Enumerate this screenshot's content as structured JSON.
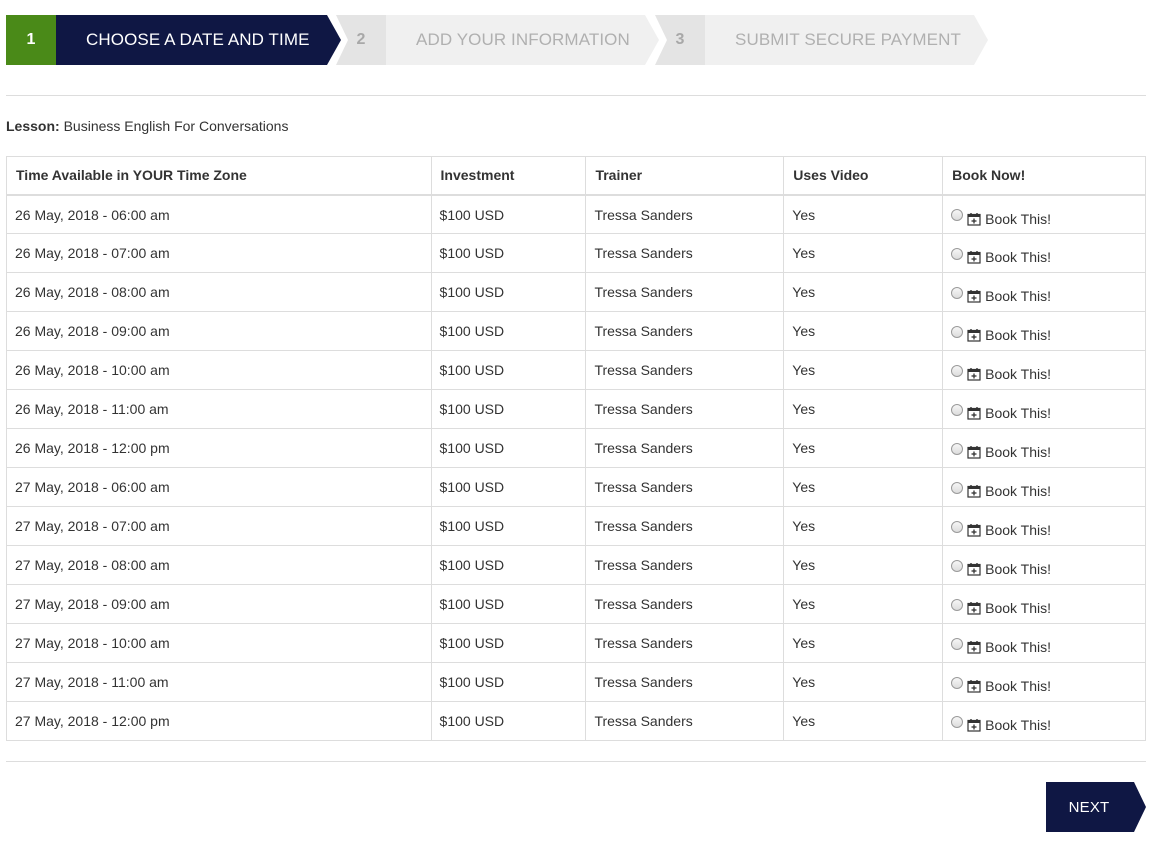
{
  "stepper": {
    "steps": [
      {
        "number": "1",
        "label": "CHOOSE A DATE AND TIME"
      },
      {
        "number": "2",
        "label": "ADD YOUR INFORMATION"
      },
      {
        "number": "3",
        "label": "SUBMIT SECURE PAYMENT"
      }
    ]
  },
  "lesson": {
    "label": "Lesson:",
    "value": "Business English For Conversations"
  },
  "table": {
    "headers": [
      "Time Available in YOUR Time Zone",
      "Investment",
      "Trainer",
      "Uses Video",
      "Book Now!"
    ],
    "rows": [
      {
        "time": "26 May, 2018 - 06:00 am",
        "investment": "$100 USD",
        "trainer": "Tressa Sanders",
        "video": "Yes",
        "book": "Book This!"
      },
      {
        "time": "26 May, 2018 - 07:00 am",
        "investment": "$100 USD",
        "trainer": "Tressa Sanders",
        "video": "Yes",
        "book": "Book This!"
      },
      {
        "time": "26 May, 2018 - 08:00 am",
        "investment": "$100 USD",
        "trainer": "Tressa Sanders",
        "video": "Yes",
        "book": "Book This!"
      },
      {
        "time": "26 May, 2018 - 09:00 am",
        "investment": "$100 USD",
        "trainer": "Tressa Sanders",
        "video": "Yes",
        "book": "Book This!"
      },
      {
        "time": "26 May, 2018 - 10:00 am",
        "investment": "$100 USD",
        "trainer": "Tressa Sanders",
        "video": "Yes",
        "book": "Book This!"
      },
      {
        "time": "26 May, 2018 - 11:00 am",
        "investment": "$100 USD",
        "trainer": "Tressa Sanders",
        "video": "Yes",
        "book": "Book This!"
      },
      {
        "time": "26 May, 2018 - 12:00 pm",
        "investment": "$100 USD",
        "trainer": "Tressa Sanders",
        "video": "Yes",
        "book": "Book This!"
      },
      {
        "time": "27 May, 2018 - 06:00 am",
        "investment": "$100 USD",
        "trainer": "Tressa Sanders",
        "video": "Yes",
        "book": "Book This!"
      },
      {
        "time": "27 May, 2018 - 07:00 am",
        "investment": "$100 USD",
        "trainer": "Tressa Sanders",
        "video": "Yes",
        "book": "Book This!"
      },
      {
        "time": "27 May, 2018 - 08:00 am",
        "investment": "$100 USD",
        "trainer": "Tressa Sanders",
        "video": "Yes",
        "book": "Book This!"
      },
      {
        "time": "27 May, 2018 - 09:00 am",
        "investment": "$100 USD",
        "trainer": "Tressa Sanders",
        "video": "Yes",
        "book": "Book This!"
      },
      {
        "time": "27 May, 2018 - 10:00 am",
        "investment": "$100 USD",
        "trainer": "Tressa Sanders",
        "video": "Yes",
        "book": "Book This!"
      },
      {
        "time": "27 May, 2018 - 11:00 am",
        "investment": "$100 USD",
        "trainer": "Tressa Sanders",
        "video": "Yes",
        "book": "Book This!"
      },
      {
        "time": "27 May, 2018 - 12:00 pm",
        "investment": "$100 USD",
        "trainer": "Tressa Sanders",
        "video": "Yes",
        "book": "Book This!"
      }
    ]
  },
  "actions": {
    "next_label": "NEXT"
  },
  "colors": {
    "navy": "#0f1744",
    "green": "#4a8a18",
    "inactive": "#f0f0f0"
  },
  "icons": {
    "book": "calendar-plus-icon"
  }
}
